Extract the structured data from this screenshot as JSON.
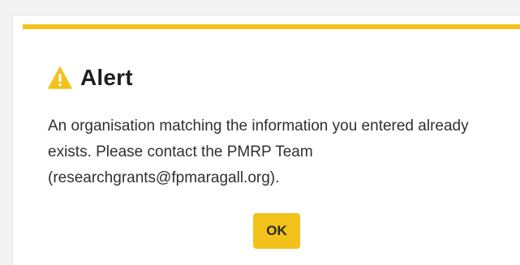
{
  "alert": {
    "title": "Alert",
    "icon": "warning-triangle-icon",
    "message": "An organisation matching the information you entered already exists. Please contact the PMRP Team (researchgrants@fpmaragall.org).",
    "ok_label": "OK"
  },
  "colors": {
    "accent": "#f2c21b",
    "background": "#ffffff",
    "text": "#303030"
  }
}
